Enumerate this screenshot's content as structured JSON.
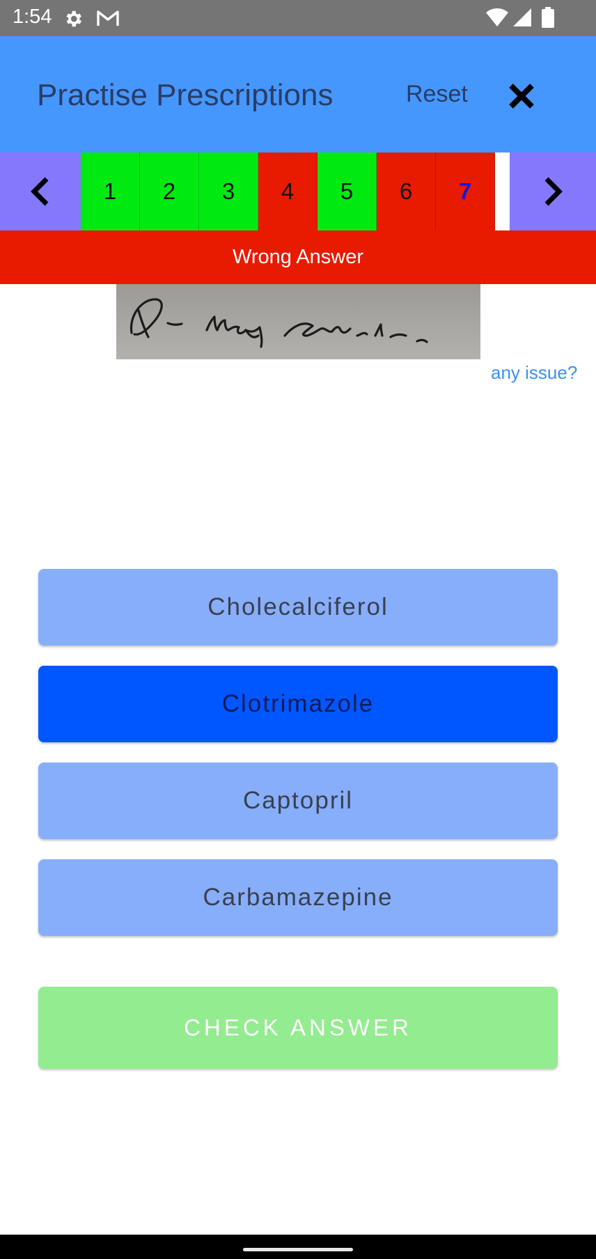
{
  "status_bar": {
    "time": "1:54",
    "icons": [
      "gear-icon",
      "gmail-icon",
      "wifi-icon",
      "signal-icon",
      "battery-icon"
    ]
  },
  "app_bar": {
    "title": "Practise Prescriptions",
    "reset_label": "Reset",
    "close_icon": "close-icon",
    "color": "#4597fd"
  },
  "question_nav": {
    "prev_icon": "chevron-left-icon",
    "next_icon": "chevron-right-icon",
    "questions": [
      {
        "label": "1",
        "status": "correct"
      },
      {
        "label": "2",
        "status": "correct"
      },
      {
        "label": "3",
        "status": "correct"
      },
      {
        "label": "4",
        "status": "wrong"
      },
      {
        "label": "5",
        "status": "correct"
      },
      {
        "label": "6",
        "status": "wrong"
      },
      {
        "label": "7",
        "status": "wrong",
        "current": true
      }
    ],
    "colors": {
      "correct": "#00ea12",
      "wrong": "#e81a00",
      "arrow": "#8479fc"
    }
  },
  "result": {
    "text": "Wrong Answer",
    "color": "#e81a00"
  },
  "prescription_image": {
    "description_icon": "handwritten-prescription-image"
  },
  "issue_link": "any issue?",
  "options": [
    {
      "label": "Cholecalciferol",
      "selected": false
    },
    {
      "label": "Clotrimazole",
      "selected": true
    },
    {
      "label": "Captopril",
      "selected": false
    },
    {
      "label": "Carbamazepine",
      "selected": false
    }
  ],
  "check_button": {
    "label": "CHECK ANSWER",
    "color": "#93ec8f"
  }
}
